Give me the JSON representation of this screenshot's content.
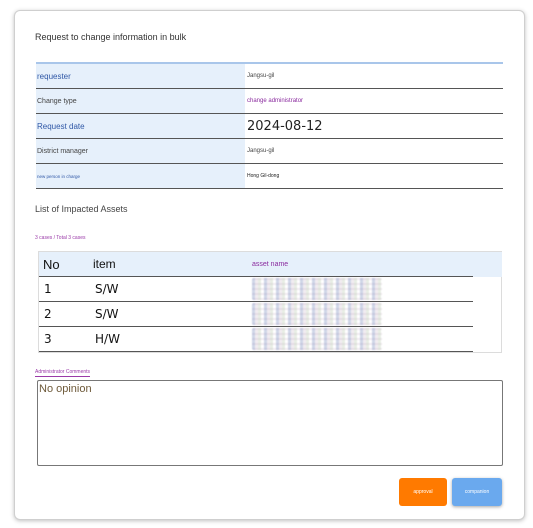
{
  "page": {
    "title": "Request to change information in bulk"
  },
  "info": {
    "rows": [
      {
        "label": "requester",
        "value": "Jangsu-gil"
      },
      {
        "label": "Change type",
        "value": "change administrator"
      },
      {
        "label": "Request date",
        "value": "2024-08-12"
      },
      {
        "label": "District manager",
        "value": "Jangsu-gil"
      },
      {
        "label": "new person in charge",
        "value": "Hong Gil-dong"
      }
    ]
  },
  "assets": {
    "section_title": "List of Impacted Assets",
    "count_text": "3 cases / Total 3 cases",
    "headers": {
      "no": "No",
      "item": "item",
      "name": "asset name"
    },
    "rows": [
      {
        "no": "1",
        "item": "S/W"
      },
      {
        "no": "2",
        "item": "S/W"
      },
      {
        "no": "3",
        "item": "H/W"
      }
    ]
  },
  "comments": {
    "label": "Administrator Comments",
    "value": "No opinion"
  },
  "buttons": {
    "approve": "approval",
    "companion": "companion"
  },
  "colors": {
    "approve": "#ff7a00",
    "companion": "#6aa9ee",
    "label_bg": "#e6f0fb",
    "accent_purple": "#8a2a9e"
  }
}
